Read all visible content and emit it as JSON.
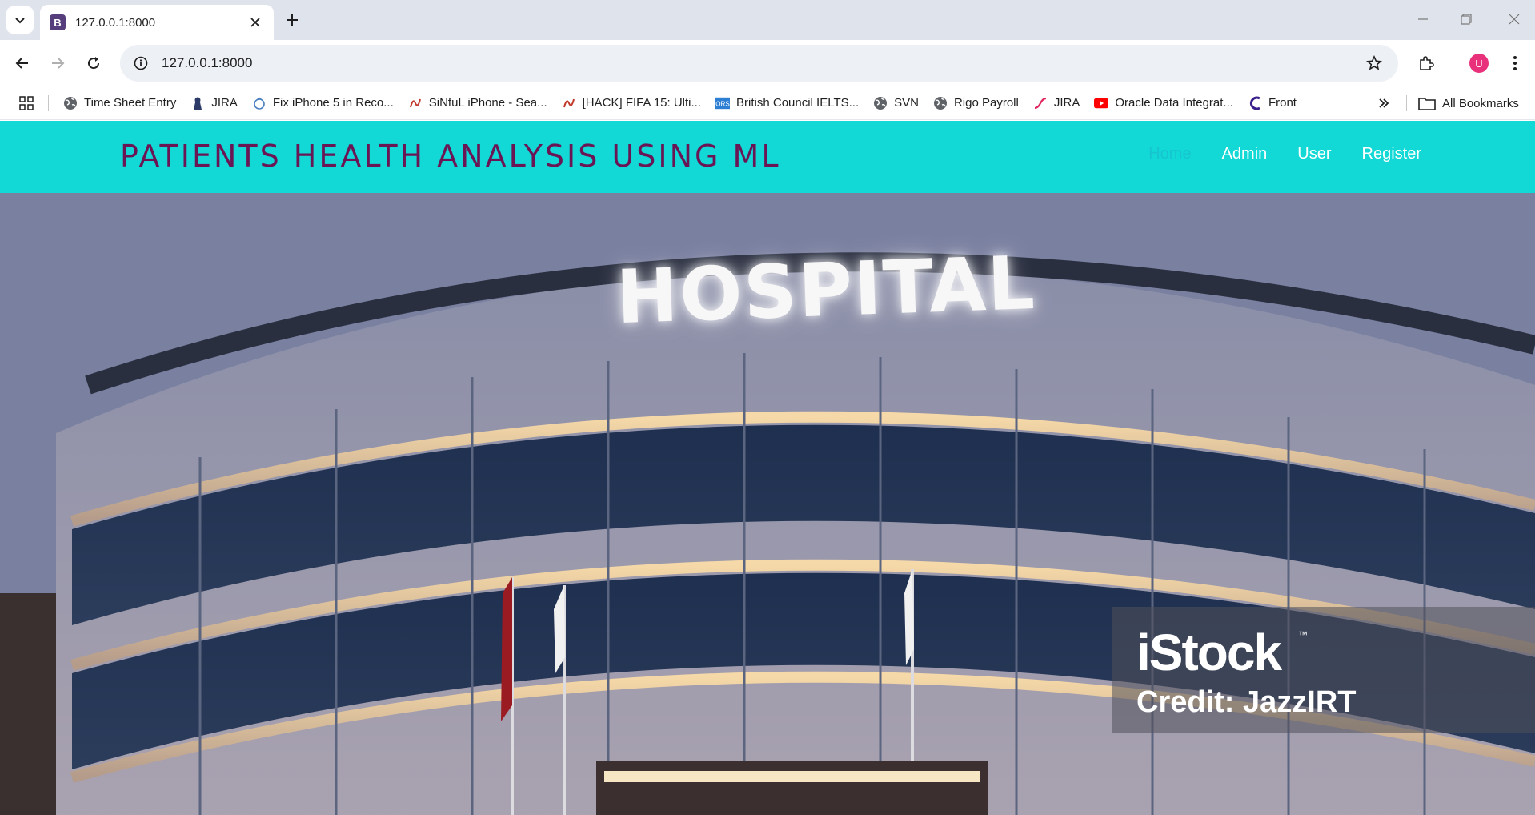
{
  "browser": {
    "tab_title": "127.0.0.1:8000",
    "tab_favicon_letter": "B",
    "url": "127.0.0.1:8000",
    "profile_initial": "U"
  },
  "bookmarks": {
    "items": [
      {
        "label": "Time Sheet Entry",
        "icon": "globe-icon"
      },
      {
        "label": "JIRA",
        "icon": "jira-icon"
      },
      {
        "label": "Fix iPhone 5 in Reco...",
        "icon": "bookmark-icon"
      },
      {
        "label": "SiNfuL iPhone - Sea...",
        "icon": "bookmark-icon"
      },
      {
        "label": "[HACK] FIFA 15: Ulti...",
        "icon": "bookmark-icon"
      },
      {
        "label": "British Council IELTS...",
        "icon": "ors-icon"
      },
      {
        "label": "SVN",
        "icon": "globe-icon"
      },
      {
        "label": "Rigo Payroll",
        "icon": "globe-icon"
      },
      {
        "label": "JIRA",
        "icon": "jira-icon"
      },
      {
        "label": "Oracle Data Integrat...",
        "icon": "youtube-icon"
      },
      {
        "label": "Front",
        "icon": "front-icon"
      }
    ],
    "all_bookmarks": "All Bookmarks"
  },
  "site": {
    "brand": "PATIENTS HEALTH ANALYSIS USING ML",
    "menu": [
      "Home",
      "Admin",
      "User",
      "Register"
    ],
    "active_menu": "Home",
    "nav_color": "#12d8d6",
    "brand_color": "#6b1654"
  },
  "hero": {
    "sign_text": "HOSPITAL",
    "watermark_logo": "iStock",
    "watermark_tm": "™",
    "watermark_credit": "Credit: JazzIRT"
  }
}
